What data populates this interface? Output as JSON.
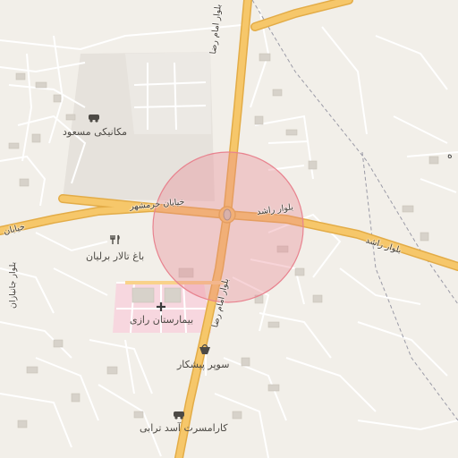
{
  "map": {
    "accent_colors": {
      "background": "#f2efe9",
      "road_major": "#f6c76a",
      "road_casing": "#e3ac47",
      "road_minor": "#ffffff",
      "building": "#d2cdc5",
      "hospital": "#f7d2dd",
      "highlight_circle": "#e8838f"
    },
    "roads": {
      "imam_reza_top": "بلوار امام رضا",
      "imam_reza_bottom": "بلوار امام رضا",
      "rashed_center": "بلوار راشد",
      "rashed_east": "بلوار راشد",
      "khorramshahr": "خیابان خرمشهر",
      "khayaban_west": "خیابان",
      "bolvar_janbazan": "بلوار جانبازان"
    },
    "places": {
      "mechanic": "مکانیکی مسعود",
      "garden_hall": "باغ تالار برلیان",
      "hospital": "بیمارستان رازی",
      "supermarket": "سوپر پیشکار",
      "car_wash": "کارامسرت آسد ترابی"
    },
    "icons": {
      "mechanic": "car-repair-icon",
      "garden_hall": "restaurant-icon",
      "hospital": "hospital-icon",
      "supermarket": "shopping-basket-icon",
      "car_wash": "car-icon",
      "roundabout": "roundabout-icon"
    }
  }
}
